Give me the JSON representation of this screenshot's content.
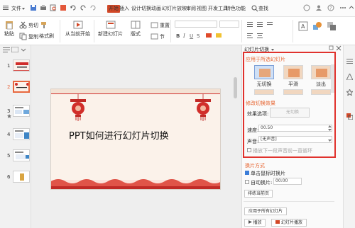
{
  "menubar": {
    "file_label": "文件",
    "tabs": [
      "开始",
      "插入",
      "设计",
      "切换",
      "动画",
      "幻灯片放映",
      "审阅",
      "视图",
      "开发工具",
      "特色功能"
    ],
    "search_label": "查找"
  },
  "ribbon": {
    "paste": "粘贴",
    "cut": "剪切",
    "copy": "复制",
    "format_painter": "格式刷",
    "from_start": "从当前开始",
    "new_slide": "新建幻灯片",
    "layout": "版式",
    "section": "节",
    "reset": "重置"
  },
  "thumbnails": {
    "numbers": [
      "1",
      "2",
      "3",
      "4",
      "5",
      "6"
    ]
  },
  "slide": {
    "title": "PPT如何进行幻灯片切换"
  },
  "pane": {
    "title": "幻灯片切换",
    "apply_selected_header": "应用于所选幻灯片",
    "effects": [
      "无切换",
      "平滑",
      "淡出"
    ],
    "modify_header": "修改切换效果",
    "effect_options_label": "效果选项:",
    "effect_options_value": "无切换",
    "speed_label": "速度:",
    "speed_value": "00.50",
    "sound_label": "声音:",
    "sound_value": "[无声音]",
    "loop_label": "播放下一段声音前一直循环",
    "advance_header": "换片方式",
    "on_click_label": "单击鼠标时换片",
    "auto_label": "自动换片:",
    "auto_value": "00:00",
    "rehearse_button": "排练当前页",
    "apply_all_button": "应用于所有幻灯片",
    "play_button": "播放",
    "slideshow_button": "幻灯片播放"
  },
  "colors": {
    "accent": "#d24726",
    "highlight": "#e0322d",
    "section_text": "#e6632e"
  }
}
